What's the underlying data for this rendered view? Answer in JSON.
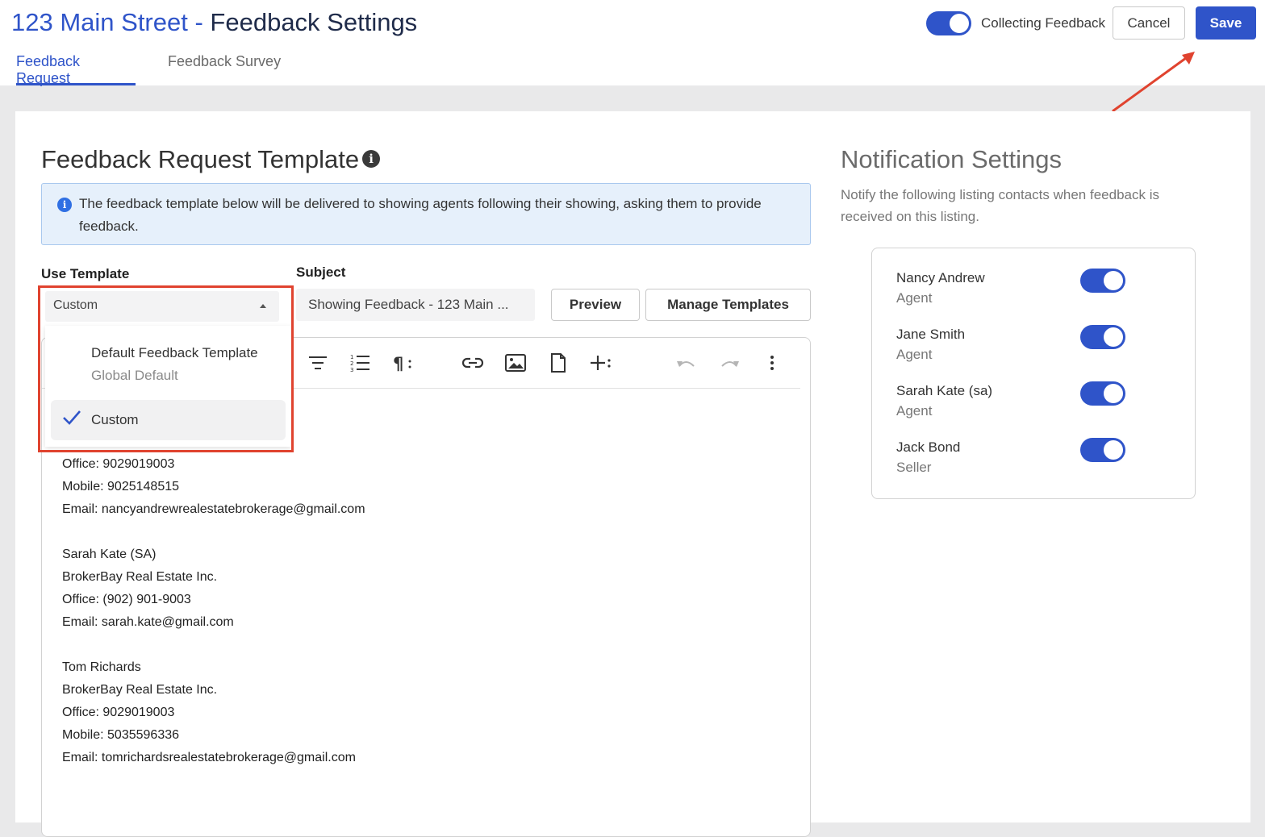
{
  "header": {
    "address": "123 Main Street",
    "separator": " - ",
    "page_name": "Feedback Settings",
    "collecting_label": "Collecting Feedback",
    "collecting_on": true,
    "cancel_label": "Cancel",
    "save_label": "Save"
  },
  "tabs": [
    {
      "label": "Feedback Request",
      "active": true
    },
    {
      "label": "Feedback Survey",
      "active": false
    }
  ],
  "template_section": {
    "heading": "Feedback Request Template",
    "info_symbol": "i",
    "banner_text": "The feedback template below will be delivered to showing agents following their showing, asking them to provide feedback.",
    "use_template_label": "Use Template",
    "use_template_value": "Custom",
    "subject_label": "Subject",
    "subject_value": "Showing Feedback - 123 Main ...",
    "preview_label": "Preview",
    "manage_label": "Manage Templates"
  },
  "dropdown": {
    "options": [
      {
        "label": "Default Feedback Template",
        "sublabel": "Global Default",
        "selected": false
      },
      {
        "label": "Custom",
        "sublabel": "",
        "selected": true
      }
    ]
  },
  "toolbar_icons": [
    "align-icon",
    "numbered-list-icon",
    "paragraph-icon",
    "link-icon",
    "image-icon",
    "file-icon",
    "insert-icon",
    "undo-icon",
    "redo-icon",
    "more-icon"
  ],
  "editor_body": {
    "block1": [
      "Office: 9029019003",
      "Mobile: 9025148515",
      "Email: nancyandrewrealestatebrokerage@gmail.com"
    ],
    "block2": [
      "Sarah Kate (SA)",
      "BrokerBay Real Estate Inc.",
      "Office: (902) 901-9003",
      "Email: sarah.kate@gmail.com"
    ],
    "block3": [
      "Tom Richards",
      "BrokerBay Real Estate Inc.",
      "Office: 9029019003",
      "Mobile: 5035596336",
      "Email: tomrichardsrealestatebrokerage@gmail.com"
    ]
  },
  "notifications": {
    "heading": "Notification Settings",
    "description": "Notify the following listing contacts when feedback is received on this listing.",
    "contacts": [
      {
        "name": "Nancy Andrew",
        "role": "Agent",
        "enabled": true
      },
      {
        "name": "Jane Smith",
        "role": "Agent",
        "enabled": true
      },
      {
        "name": "Sarah Kate (sa)",
        "role": "Agent",
        "enabled": true
      },
      {
        "name": "Jack Bond",
        "role": "Seller",
        "enabled": true
      }
    ]
  },
  "colors": {
    "primary": "#2f54c9",
    "highlight_box": "#e0432f",
    "banner_bg": "#e6f0fb"
  }
}
